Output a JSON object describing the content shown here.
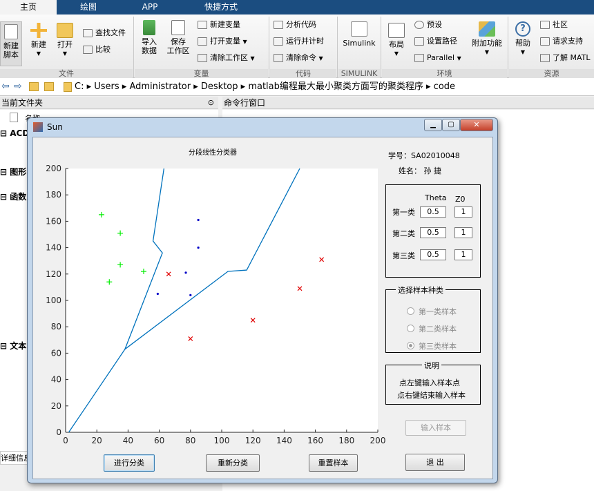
{
  "tabs": [
    {
      "label": "主页",
      "active": true
    },
    {
      "label": "绘图",
      "active": false
    },
    {
      "label": "APP",
      "active": false
    },
    {
      "label": "快捷方式",
      "active": false
    }
  ],
  "ribbon": {
    "new_script": "新建\n脚本",
    "new": "新建",
    "open": "打开",
    "find_files": "查找文件",
    "compare": "比较",
    "import_data": "导入\n数据",
    "save_workspace": "保存\n工作区",
    "new_variable": "新建变量",
    "open_variable": "打开变量",
    "clear_workspace": "清除工作区",
    "analyze_code": "分析代码",
    "run_and_time": "运行并计时",
    "clear_commands": "清除命令",
    "simulink": "Simulink",
    "layout": "布局",
    "preferences": "预设",
    "set_path": "设置路径",
    "parallel": "Parallel",
    "addons": "附加功能",
    "help": "帮助",
    "community": "社区",
    "request_support": "请求支持",
    "learn_matlab": "了解 MATL",
    "groups": [
      "文件",
      "变量",
      "代码",
      "SIMULINK",
      "环境",
      "资源"
    ]
  },
  "address": {
    "path": [
      "C:",
      "Users",
      "Administrator",
      "Desktop",
      "matlab编程最大最小聚类方面写的聚类程序",
      "code"
    ]
  },
  "left_panel": {
    "title": "当前文件夹",
    "name_col": "名称",
    "sections": [
      "ACD",
      "图形",
      "函数",
      "文本"
    ],
    "details": "详细信息"
  },
  "command_window": {
    "title": "命令行窗口"
  },
  "figure": {
    "title": "Sun",
    "plot_title": "分段线性分类器",
    "student_id": "学号：SA02010048",
    "student_name": "姓名：  孙  捷",
    "params": {
      "header_theta": "Theta",
      "header_z0": "Z0",
      "rows": [
        {
          "label": "第一类",
          "theta": "0.5",
          "z0": "1"
        },
        {
          "label": "第二类",
          "theta": "0.5",
          "z0": "1"
        },
        {
          "label": "第三类",
          "theta": "0.5",
          "z0": "1"
        }
      ]
    },
    "sample_group": {
      "title": "选择样本种类",
      "options": [
        "第一类样本",
        "第二类样本",
        "第三类样本"
      ],
      "selected": "第三类样本"
    },
    "note_group": {
      "title": "说明",
      "line1": "点左键输入样本点",
      "line2": "点右键结束输入样本"
    },
    "buttons": {
      "input_samples": "输入样本",
      "classify": "进行分类",
      "reclassify": "重新分类",
      "reset_samples": "重置样本",
      "exit": "退  出"
    }
  },
  "chart_data": {
    "type": "scatter",
    "title": "分段线性分类器",
    "xlim": [
      0,
      200
    ],
    "ylim": [
      0,
      200
    ],
    "xticks": [
      0,
      20,
      40,
      60,
      80,
      100,
      120,
      140,
      160,
      180,
      200
    ],
    "yticks": [
      0,
      20,
      40,
      60,
      80,
      100,
      120,
      140,
      160,
      180,
      200
    ],
    "grid": false,
    "series": [
      {
        "marker": "+",
        "color": "#00ee00",
        "points": [
          [
            23,
            165
          ],
          [
            35,
            151
          ],
          [
            35,
            127
          ],
          [
            50,
            122
          ],
          [
            28,
            114
          ]
        ]
      },
      {
        "marker": ".",
        "color": "#0000c8",
        "points": [
          [
            85,
            161
          ],
          [
            85,
            140
          ],
          [
            77,
            121
          ],
          [
            59,
            105
          ],
          [
            80,
            104
          ]
        ]
      },
      {
        "marker": "x",
        "color": "#e00000",
        "points": [
          [
            164,
            131
          ],
          [
            66,
            120
          ],
          [
            150,
            109
          ],
          [
            120,
            85
          ],
          [
            80,
            71
          ]
        ]
      }
    ],
    "boundaries": [
      {
        "color": "#0072bd",
        "points": [
          [
            2,
            0
          ],
          [
            38,
            63
          ],
          [
            62,
            136
          ],
          [
            56,
            145
          ],
          [
            63,
            200
          ]
        ]
      },
      {
        "color": "#0072bd",
        "points": [
          [
            38,
            63
          ],
          [
            104,
            122
          ],
          [
            116,
            123
          ],
          [
            150,
            200
          ]
        ]
      }
    ]
  }
}
